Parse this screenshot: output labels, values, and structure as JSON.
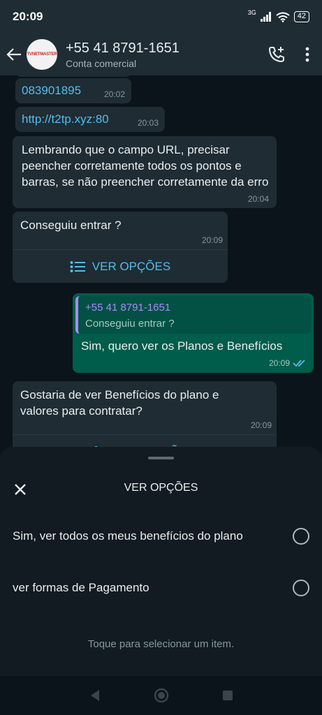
{
  "status_bar": {
    "time": "20:09",
    "network": "3G",
    "battery": "42"
  },
  "header": {
    "contact_name": "+55 41 8791-1651",
    "contact_sub": "Conta comercial",
    "logo_text": "TVNETMASTER"
  },
  "messages": [
    {
      "id": "m1",
      "text": "083901895",
      "time": "20:02",
      "is_link": true
    },
    {
      "id": "m2",
      "text": "http://t2tp.xyz:80",
      "time": "20:03",
      "is_link": true
    },
    {
      "id": "m3",
      "text": "Lembrando que o campo URL, precisar peencher corretamente todos os pontos e barras, se não preencher corretamente da erro",
      "time": "20:04"
    },
    {
      "id": "m4",
      "text": "Conseguiu entrar ?",
      "time": "20:09",
      "button": "VER OPÇÕES"
    },
    {
      "id": "m5",
      "quote_name": "+55 41 8791-1651",
      "quote_text": "Conseguiu entrar ?",
      "text": "Sim, quero ver os Planos e Benefícios",
      "time": "20:09",
      "outgoing": true
    },
    {
      "id": "m6",
      "text": "Gostaria de ver Benefícios do plano e valores para contratar?",
      "time": "20:09",
      "button": "VER OPÇÕES"
    }
  ],
  "sheet": {
    "title": "VER OPÇÕES",
    "options": [
      {
        "label": "Sim, ver todos os meus benefícios do plano",
        "selected": false
      },
      {
        "label": "ver formas de Pagamento",
        "selected": false
      }
    ],
    "hint": "Toque para selecionar um item."
  },
  "colors": {
    "accent_link": "#53bdeb",
    "outgoing_bubble": "#005c4b",
    "incoming_bubble": "#1f2c34",
    "quote_name": "#a78bfa"
  }
}
